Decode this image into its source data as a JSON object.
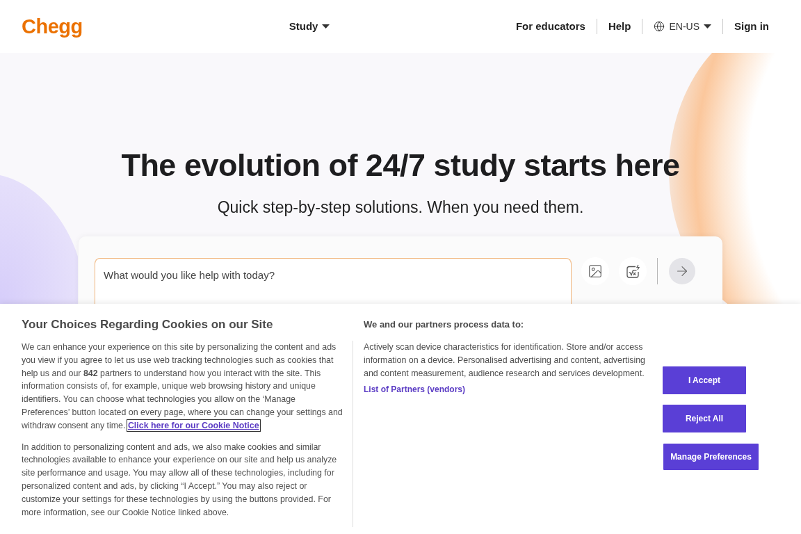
{
  "header": {
    "logo": "Chegg",
    "nav": [
      {
        "label": "Study"
      }
    ],
    "links": [
      {
        "label": "For educators",
        "kind": "link"
      },
      {
        "label": "Help",
        "kind": "link"
      },
      {
        "label": "EN-US",
        "kind": "language"
      },
      {
        "label": "Sign in",
        "kind": "link"
      }
    ]
  },
  "hero": {
    "title": "The evolution of 24/7 study starts here",
    "subtitle": "Quick step-by-step solutions. When you need them.",
    "search": {
      "placeholder": "What would you like help with today?"
    }
  },
  "cookie_banner": {
    "title": "Your Choices Regarding Cookies on our Site",
    "paragraphs": [
      {
        "text": "We can enhance your experience on this site by personalizing the content and ads you view if you agree to let us use web tracking technologies such as cookies that help us and our **842** partners to understand how you interact with the site. This information consists of, for example, unique web browsing history and unique identifiers. You can choose what technologies you allow on the ‘Manage Preferences’ button located on every page, where you can change your settings and withdraw consent any time.",
        "link": {
          "label": "Click here for our Cookie Notice",
          "focused": true
        }
      },
      {
        "text": "In addition to personalizing content and ads, we also make cookies and similar technologies available to enhance your experience on our site and help us analyze site performance and usage. You may allow all of these technologies, including for personalized content and ads, by clicking “I Accept.” You may also reject or customize your settings for these technologies by using the buttons provided. For more information, see our Cookie Notice linked above."
      }
    ],
    "purposes": {
      "title": "We and our partners process data to:",
      "text": "Actively scan device characteristics for identification. Store and/or access information on a device. Personalised advertising and content, advertising and content measurement, audience research and services development.",
      "link": "List of Partners (vendors)"
    },
    "buttons": [
      {
        "label": "I Accept"
      },
      {
        "label": "Reject All"
      },
      {
        "label": "Manage Preferences"
      }
    ]
  }
}
